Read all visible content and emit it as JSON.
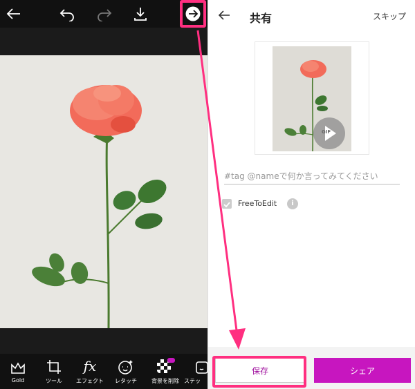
{
  "editor": {
    "tools": [
      {
        "label": "Gold",
        "icon": "crown-icon"
      },
      {
        "label": "ツール",
        "icon": "crop-icon"
      },
      {
        "label": "エフェクト",
        "icon": "fx-icon"
      },
      {
        "label": "レタッチ",
        "icon": "retouch-face-icon"
      },
      {
        "label": "背景を削除",
        "icon": "remove-background-icon"
      },
      {
        "label": "ステッ",
        "icon": "sticker-icon"
      }
    ],
    "fx_glyph": "fx"
  },
  "share": {
    "title": "共有",
    "skip": "スキップ",
    "gif_label": "GIF",
    "caption_placeholder": "#tag @nameで何か言ってみてください",
    "free_to_edit": "FreeToEdit",
    "info_glyph": "i",
    "save_label": "保存",
    "share_label": "シェア"
  },
  "colors": {
    "accent": "#c716bf",
    "highlight": "#ff2f80"
  }
}
